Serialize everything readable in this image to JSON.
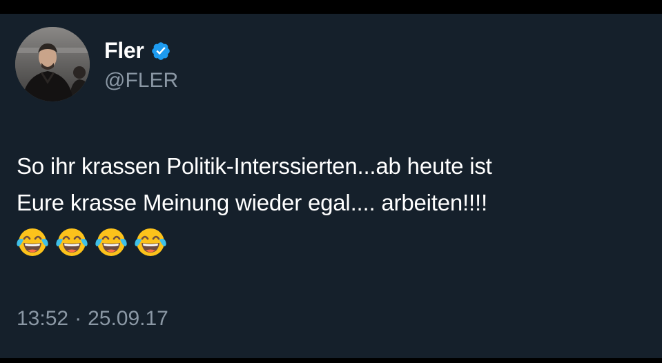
{
  "tweet": {
    "author": {
      "display_name": "Fler",
      "handle": "@FLER",
      "verified": true,
      "avatar_icon": "profile-photo-avatar"
    },
    "text_lines": [
      "So ihr krassen Politik-Interssierten...ab heute ist",
      "Eure krasse Meinung wieder egal.... arbeiten!!!!"
    ],
    "emojis": [
      "face-with-tears-of-joy",
      "face-with-tears-of-joy",
      "face-with-tears-of-joy",
      "face-with-tears-of-joy"
    ],
    "time": "13:52",
    "separator": "·",
    "date": "25.09.17"
  },
  "colors": {
    "card_background": "#15202b",
    "outer_background": "#000000",
    "primary_text": "#ffffff",
    "secondary_text": "#8b98a5",
    "verified_badge": "#1d9bf0",
    "emoji_yellow": "#fcc21b"
  }
}
